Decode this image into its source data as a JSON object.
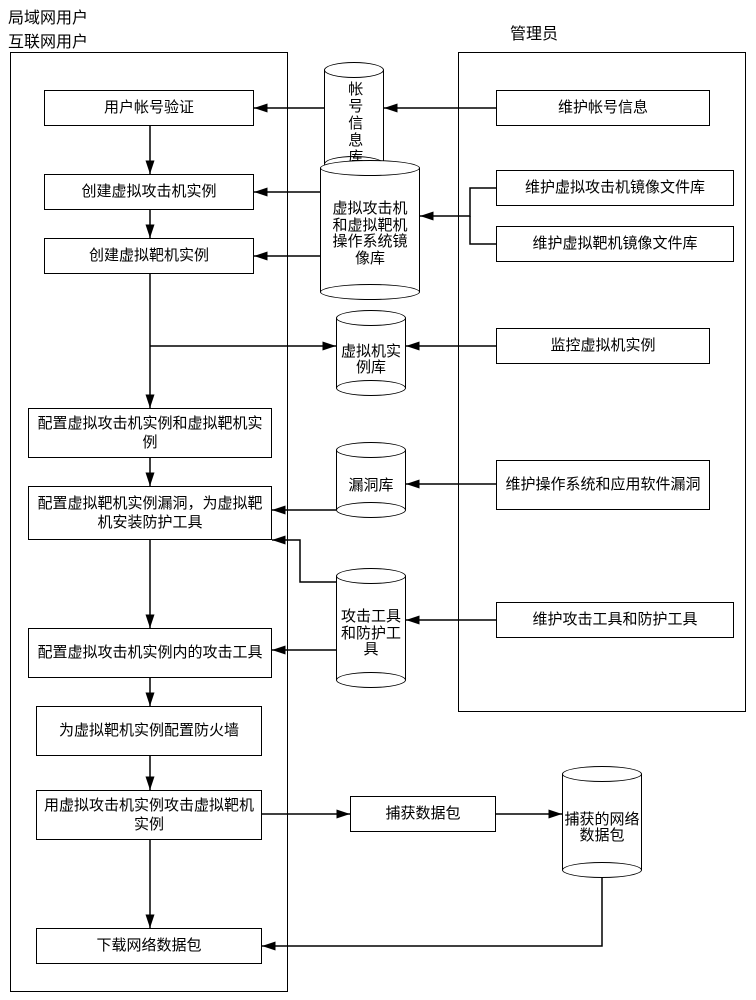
{
  "labels": {
    "top_left": "局域网用户\n互联网用户",
    "top_right": "管理员"
  },
  "user_column": {
    "b1": "用户帐号验证",
    "b2": "创建虚拟攻击机实例",
    "b3": "创建虚拟靶机实例",
    "b4": "配置虚拟攻击机实例和虚拟靶机实例",
    "b5": "配置虚拟靶机实例漏洞，为虚拟靶机安装防护工具",
    "b6": "配置虚拟攻击机实例内的攻击工具",
    "b7": "为虚拟靶机实例配置防火墙",
    "b8": "用虚拟攻击机实例攻击虚拟靶机实例",
    "b9": "下载网络数据包"
  },
  "admin_column": {
    "a1": "维护帐号信息",
    "a2": "维护虚拟攻击机镜像文件库",
    "a3": "维护虚拟靶机镜像文件库",
    "a4": "监控虚拟机实例",
    "a5": "维护操作系统和应用软件漏洞",
    "a6": "维护攻击工具和防护工具"
  },
  "databases": {
    "d1": "帐号信息库",
    "d2": "虚拟攻击机和虚拟靶机操作系统镜像库",
    "d3": "虚拟机实例库",
    "d4": "漏洞库",
    "d5": "攻击工具和防护工具",
    "d6": "捕获的网络数据包"
  },
  "mid": {
    "capture": "捕获数据包"
  }
}
